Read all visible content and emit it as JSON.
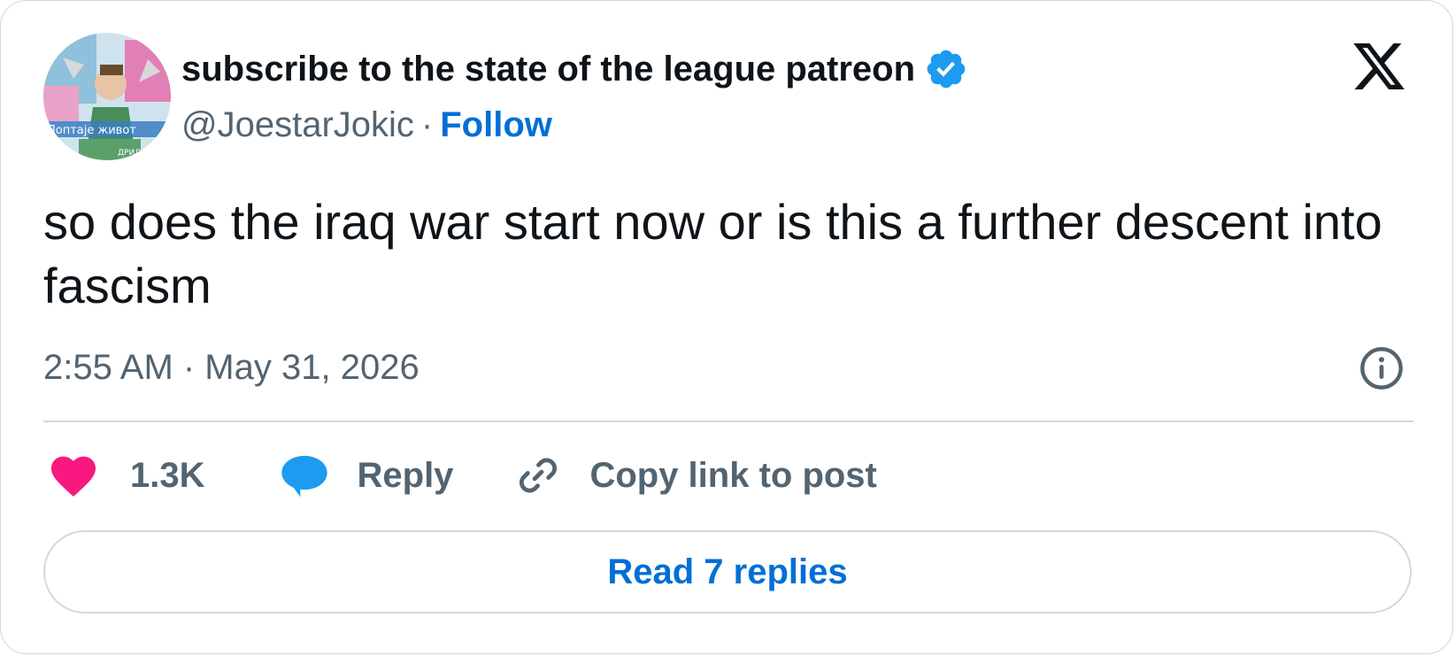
{
  "author": {
    "display_name": "subscribe to the state of the league patreon",
    "handle": "@JoestarJokic",
    "separator": "·",
    "follow_label": "Follow",
    "avatar_text_lines": [
      "Поптаје живот",
      "ДРИЛ"
    ]
  },
  "tweet": {
    "text": "so does the iraq war start now or is this a further descent into fascism",
    "timestamp": "2:55 AM · May 31, 2026"
  },
  "actions": {
    "like_count": "1.3K",
    "reply_label": "Reply",
    "copy_link_label": "Copy link to post"
  },
  "footer": {
    "read_replies_label": "Read 7 replies"
  },
  "icons": {
    "verified": "verified-badge-icon",
    "x_logo": "x-logo-icon",
    "info": "info-icon",
    "like": "heart-icon",
    "reply": "speech-bubble-icon",
    "copy": "link-icon"
  },
  "colors": {
    "text": "#0f1419",
    "secondary": "#536471",
    "link": "#006fd6",
    "verified": "#1d9bf0",
    "like": "#f91880",
    "reply": "#1d9bf0",
    "border": "#cfd9de"
  }
}
